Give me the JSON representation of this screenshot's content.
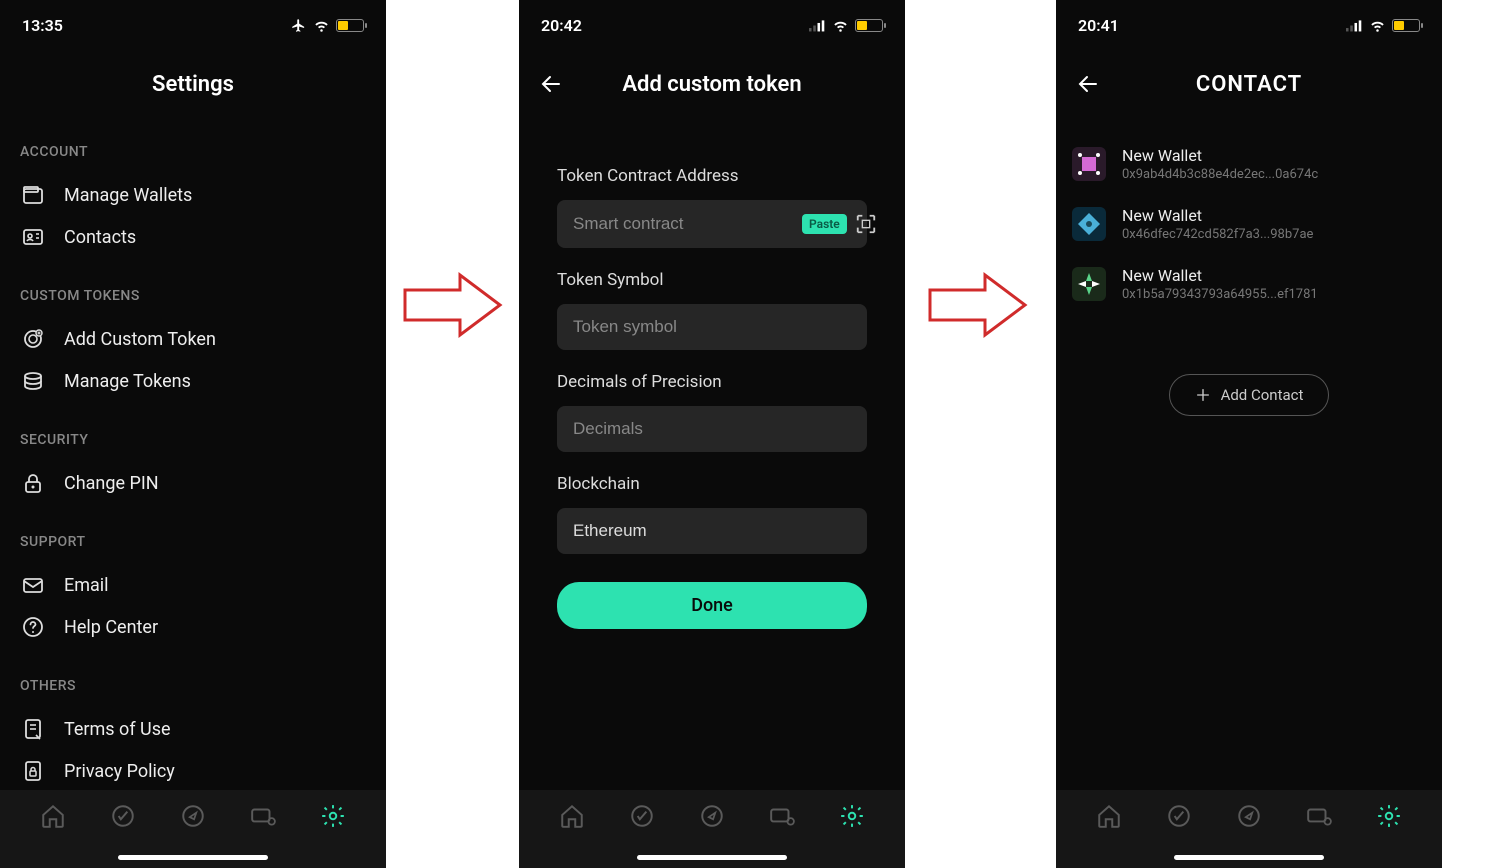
{
  "screen1": {
    "statusTime": "13:35",
    "title": "Settings",
    "sections": {
      "account": {
        "title": "ACCOUNT",
        "items": {
          "manage_wallets": "Manage Wallets",
          "contacts": "Contacts"
        }
      },
      "custom_tokens": {
        "title": "CUSTOM TOKENS",
        "items": {
          "add": "Add Custom Token",
          "manage": "Manage Tokens"
        }
      },
      "security": {
        "title": "SECURITY",
        "items": {
          "pin": "Change PIN"
        }
      },
      "support": {
        "title": "SUPPORT",
        "items": {
          "email": "Email",
          "help": "Help Center"
        }
      },
      "others": {
        "title": "OTHERS",
        "items": {
          "terms": "Terms of Use",
          "privacy": "Privacy Policy"
        }
      }
    }
  },
  "screen2": {
    "statusTime": "20:42",
    "title": "Add custom token",
    "labels": {
      "contract": "Token Contract Address",
      "symbol": "Token Symbol",
      "decimals": "Decimals of Precision",
      "blockchain": "Blockchain"
    },
    "placeholders": {
      "contract": "Smart contract",
      "symbol": "Token symbol",
      "decimals": "Decimals"
    },
    "values": {
      "blockchain": "Ethereum"
    },
    "paste": "Paste",
    "done": "Done"
  },
  "screen3": {
    "statusTime": "20:41",
    "title": "CONTACT",
    "contacts": [
      {
        "name": "New Wallet",
        "addr": "0x9ab4d4b3c88e4de2ec...0a674c"
      },
      {
        "name": "New Wallet",
        "addr": "0x46dfec742cd582f7a3...98b7ae"
      },
      {
        "name": "New Wallet",
        "addr": "0x1b5a79343793a64955...ef1781"
      }
    ],
    "addContact": "Add Contact"
  },
  "colors": {
    "accent": "#2de2b0"
  }
}
